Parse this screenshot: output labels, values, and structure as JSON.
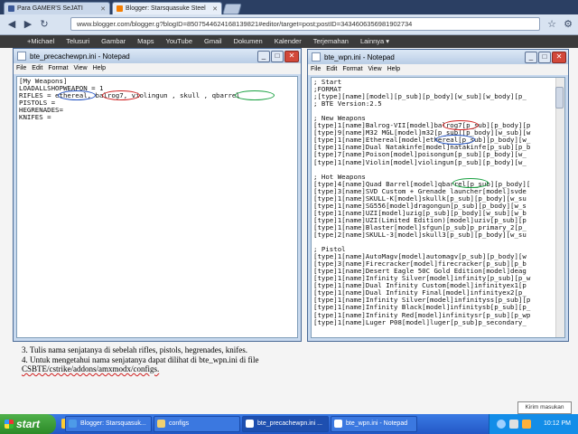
{
  "browser": {
    "tabs": [
      {
        "label": "Para GAMER'S SeJATI",
        "favicon_color": "#3b5998"
      },
      {
        "label": "Blogger: Starsquasuke Steel",
        "favicon_color": "#f57d00"
      }
    ],
    "address": "www.blogger.com/blogger.g?blogID=8507544624168139821#editor/target=post;postID=3434606356981902734",
    "bookmarks": [
      "+Michael",
      "Telusuri",
      "Gambar",
      "Maps",
      "YouTube",
      "Gmail",
      "Dokumen",
      "Kalender",
      "Terjemahan",
      "Lainnya ▾"
    ]
  },
  "notepad_left": {
    "title": "bte_precachewpn.ini - Notepad",
    "menu": [
      "File",
      "Edit",
      "Format",
      "View",
      "Help"
    ],
    "content": "[My Weapons]\nLOADALLSHOPWEAPON = 1\nRIFLES = ethereal, balrog7, violingun , skull , qbarrel\nPISTOLS =\nHEGRENADES=\nKNIFES ="
  },
  "notepad_right": {
    "title": "bte_wpn.ini - Notepad",
    "menu": [
      "File",
      "Edit",
      "Format",
      "View",
      "Help"
    ],
    "content": "; Start\n;FORMAT\n;[type][name][model][p_sub][p_body][w_sub][w_body][p_\n; BTE Version:2.5\n\n; New Weapons\n[type]1[name]Balrog-VII[model]balrog7[p_sub][p_body][p\n[type]9[name]M32 MGL[model]m32[p_sub][p_body][w_sub][w\n[type]1[name]Ethereal[model]ethereal[p_sub][p_body][w_\n[type]1[name]Dual Natakinfe[model]natakinfe[p_sub][p_b\n[type]7[name]Poison[model]poisongun[p_sub][p_body][w_\n[type]1[name]Violin[model]violingun[p_sub][p_body][w_\n\n; Hot Weapons\n[type]4[name]Quad Barrel[model]qbarrel[p_sub][p_body][\n[type]3[name]SVD Custom + Grenade launcher[model]svde\n[type]1[name]SKULL-K[model]skullk[p_sub][p_body][w_su\n[type]1[name]SG556[model]dragongun[p_sub][p_body][w_s\n[type]1[name]UZI[model]uzig[p_sub][p_body][w_sub][w_b\n[type]1[name]UZI(Limited Edition)[model]uziv[p_sub][p\n[type]1[name]Blaster[model]sfgun[p_sub]p_primary_2[p_\n[type]2[name]SKULL-3[model]skull3[p_sub][p_body][w_su\n\n; Pistol\n[type]1[name]AutoMagv[model]automagv[p_sub][p_body][w\n[type]3[name]Firecracker[model]firecracker[p_sub][p_b\n[type]1[name]Desert Eagle 50C Gold Edition[model]deag\n[type]1[name]Infinity Silver[model]infinity[p_sub][p_w\n[type]1[name]Dual Infinity Custom[model]infinityex1[p\n[type]1[name]Dual Infinity Final[model]infinityex2[p_\n[type]1[name]Infinity Silver[model]infinityss[p_sub][p\n[type]1[name]Infinity Black[model]infinitysb[p_sub][p_\n[type]1[name]Infinity Red[model]infinitysr[p_sub][p_wp\n[type]1[name]Luger P08[model]luger[p_sub]p_secondary_"
  },
  "blog_text": {
    "line3": "3. Tulis nama senjatanya di sebelah rifles, pistols, hegrenades, knifes.",
    "line4a": "4. Untuk mengetahui nama senjatanya dapat dilihat di bte_wpn.ini di file",
    "line4b": "CSBTE/cstrike/addons/amxmodx/configs."
  },
  "tooltip": "Kirim masukan",
  "taskbar": {
    "start_label": "start",
    "buttons": [
      {
        "label": "Blogger: Starsquasuk..."
      },
      {
        "label": "configs"
      },
      {
        "label": "bte_precachewpn.ini ..."
      },
      {
        "label": "bte_wpn.ini - Notepad"
      }
    ],
    "language": "EN",
    "clock": "10:12 PM"
  }
}
